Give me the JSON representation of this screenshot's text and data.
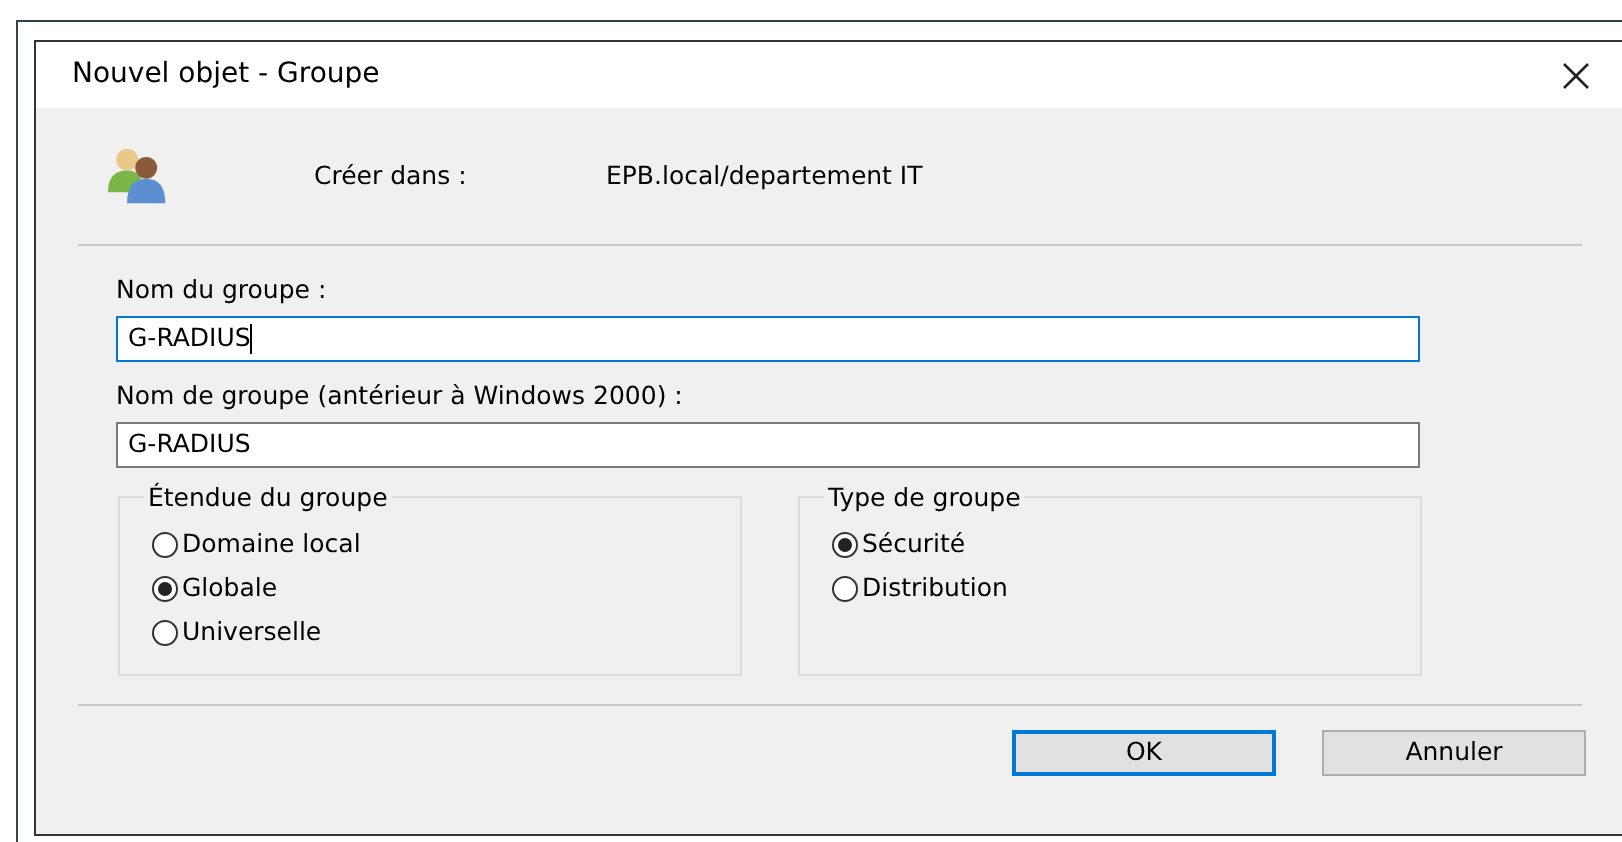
{
  "window": {
    "title": "Nouvel objet - Groupe"
  },
  "location": {
    "label": "Créer dans :",
    "path": "EPB.local/departement IT"
  },
  "fields": [
    {
      "label": "Nom du groupe :",
      "value": "G-RADIUS",
      "focused": true
    },
    {
      "label": "Nom de groupe (antérieur à Windows 2000) :",
      "value": "G-RADIUS",
      "focused": false
    }
  ],
  "groups": [
    {
      "title": "Étendue du groupe",
      "options": [
        {
          "label": "Domaine local",
          "selected": false
        },
        {
          "label": "Globale",
          "selected": true
        },
        {
          "label": "Universelle",
          "selected": false
        }
      ]
    },
    {
      "title": "Type de groupe",
      "options": [
        {
          "label": "Sécurité",
          "selected": true
        },
        {
          "label": "Distribution",
          "selected": false
        }
      ]
    }
  ],
  "buttons": [
    {
      "label": "OK",
      "default": true
    },
    {
      "label": "Annuler",
      "default": false
    }
  ]
}
